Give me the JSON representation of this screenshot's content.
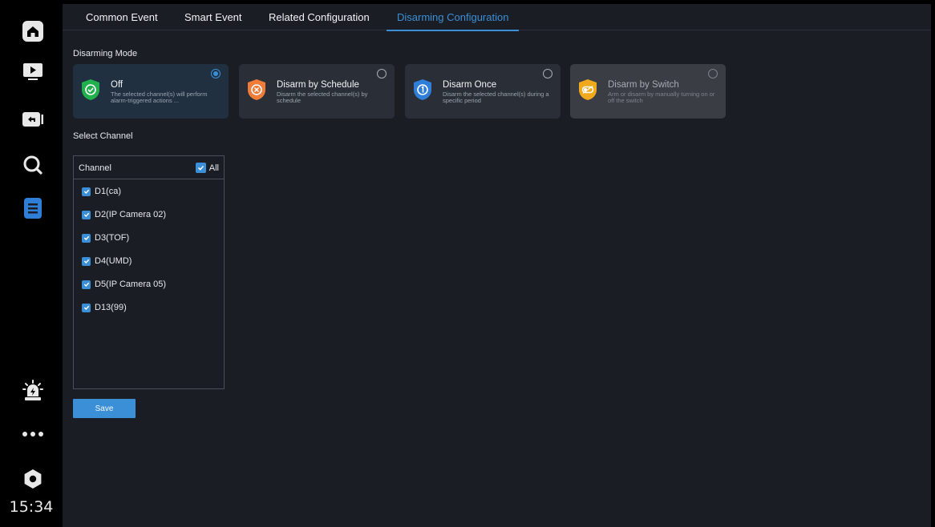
{
  "sidebar": {
    "clock": "15:34",
    "items": [
      {
        "icon": "home-icon"
      },
      {
        "icon": "playback-icon"
      },
      {
        "icon": "backup-icon"
      },
      {
        "icon": "search-icon"
      },
      {
        "icon": "log-icon"
      },
      {
        "icon": "alarm-icon"
      },
      {
        "icon": "more-icon"
      },
      {
        "icon": "settings-icon"
      }
    ]
  },
  "tabs": [
    {
      "label": "Common Event"
    },
    {
      "label": "Smart Event"
    },
    {
      "label": "Related Configuration"
    },
    {
      "label": "Disarming Configuration"
    }
  ],
  "active_tab": "Disarming Configuration",
  "disarming_mode": {
    "label": "Disarming Mode",
    "options": [
      {
        "title": "Off",
        "desc": "The selected channel(s) will perform alarm-triggered actions ...",
        "color": "#22b04f",
        "selected": true
      },
      {
        "title": "Disarm by Schedule",
        "desc": "Disarm the selected channel(s) by schedule",
        "color": "#f07c3a",
        "selected": false
      },
      {
        "title": "Disarm Once",
        "desc": "Disarm the selected channel(s) during a specific period",
        "color": "#2f7fd9",
        "selected": false
      },
      {
        "title": "Disarm by Switch",
        "desc": "Arm or disarm by manually turning on or off the switch",
        "color": "#f0a91d",
        "selected": false,
        "disabled": true
      }
    ]
  },
  "select_channel": {
    "label": "Select Channel",
    "header": "Channel",
    "all_label": "All",
    "channels": [
      {
        "name": "D1(ca)",
        "checked": true
      },
      {
        "name": "D2(IP Camera 02)",
        "checked": true
      },
      {
        "name": "D3(TOF)",
        "checked": true
      },
      {
        "name": "D4(UMD)",
        "checked": true
      },
      {
        "name": "D5(IP Camera 05)",
        "checked": true
      },
      {
        "name": "D13(99)",
        "checked": true
      }
    ]
  },
  "save_label": "Save",
  "colors": {
    "accent": "#3a8fd6",
    "background": "#1b1d24",
    "sidebar_active": "#2f7fd9"
  }
}
